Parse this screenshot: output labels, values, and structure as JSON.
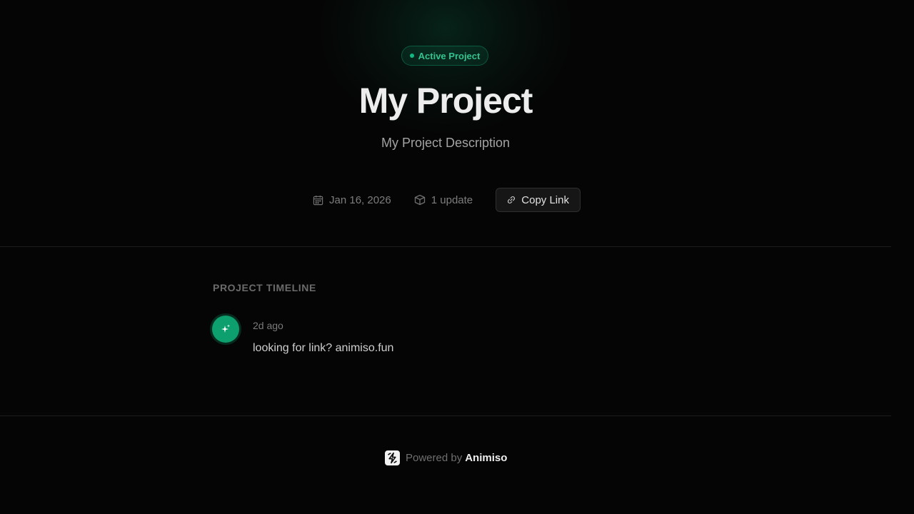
{
  "hero": {
    "badge": "Active Project",
    "title": "My Project",
    "description": "My Project Description"
  },
  "meta": {
    "date": "Jan 16, 2026",
    "updates": "1 update",
    "copy_link_label": "Copy Link"
  },
  "timeline": {
    "heading": "PROJECT TIMELINE",
    "entries": [
      {
        "time": "2d ago",
        "text": "looking for link? animiso.fun",
        "icon": "sparkles-icon"
      }
    ]
  },
  "footer": {
    "powered_by": "Powered by",
    "brand": "Animiso"
  },
  "colors": {
    "background": "#050505",
    "accent": "#10b981",
    "accent_text": "#34c38f"
  }
}
